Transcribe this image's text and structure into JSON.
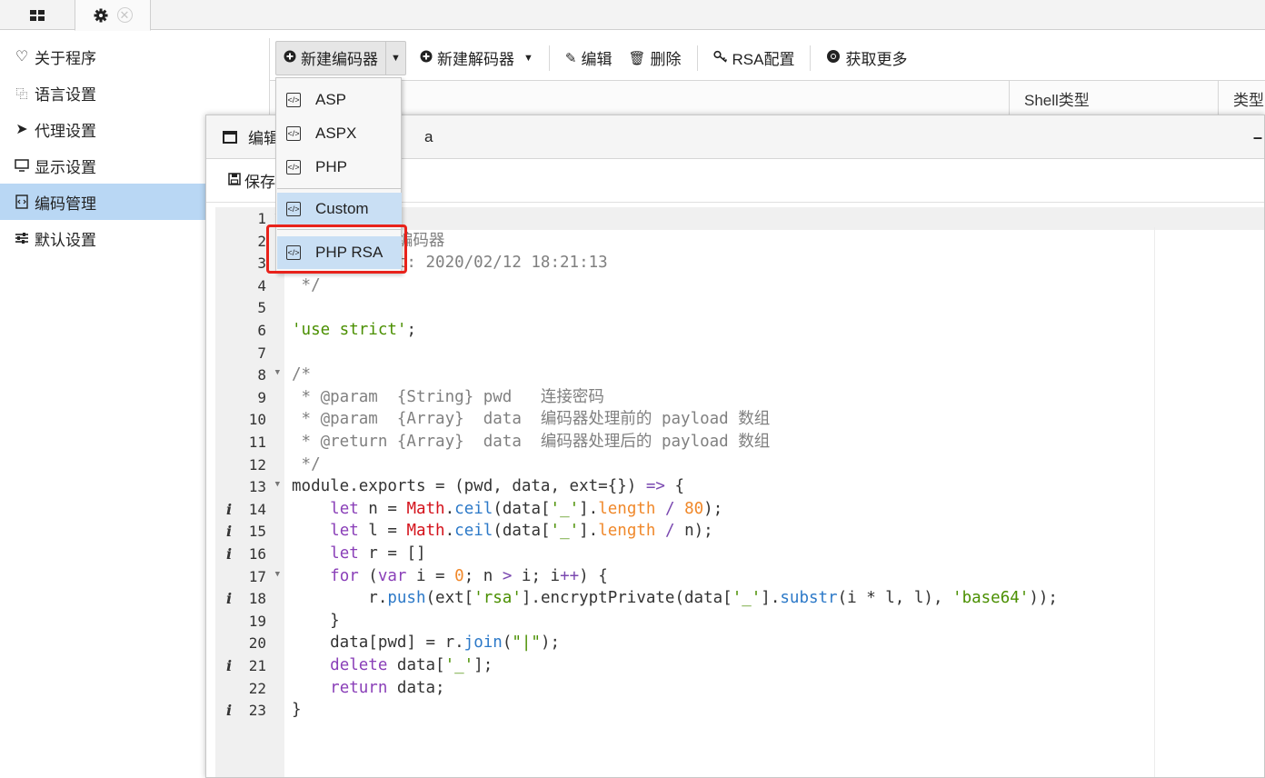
{
  "tabs": {
    "grid_icon": "grid-icon",
    "settings_icon": "gear-icon",
    "close_glyph": "✕"
  },
  "sidebar": {
    "items": [
      {
        "label": "关于程序",
        "icon": "heart-icon",
        "glyph": "♡"
      },
      {
        "label": "语言设置",
        "icon": "language-icon",
        "glyph": "🈁"
      },
      {
        "label": "代理设置",
        "icon": "paper-plane-icon",
        "glyph": "➤"
      },
      {
        "label": "显示设置",
        "icon": "monitor-icon",
        "glyph": "🖵"
      },
      {
        "label": "编码管理",
        "icon": "code-file-icon",
        "glyph": "▣"
      },
      {
        "label": "默认设置",
        "icon": "sliders-icon",
        "glyph": "☰"
      }
    ],
    "active_index": 4
  },
  "toolbar": {
    "new_encoder": "新建编码器",
    "new_decoder": "新建解码器",
    "edit": "编辑",
    "delete": "删除",
    "rsa_config": "RSA配置",
    "get_more": "获取更多"
  },
  "grid_header": {
    "shell_type": "Shell类型",
    "type": "类型"
  },
  "dropdown": {
    "items": [
      "ASP",
      "ASPX",
      "PHP",
      "Custom",
      "PHP RSA"
    ],
    "selected": "Custom"
  },
  "editor_window": {
    "title_visible": "编辑",
    "title_tail": "a",
    "save_label": "保存"
  },
  "code": {
    "lines": [
      "/**",
      " * php::RSA编码器",
      " * Create at: 2020/02/12 18:21:13",
      " */",
      "",
      "'use strict';",
      "",
      "/*",
      " * @param  {String} pwd   连接密码",
      " * @param  {Array}  data  编码器处理前的 payload 数组",
      " * @return {Array}  data  编码器处理后的 payload 数组",
      " */",
      "module.exports = (pwd, data, ext={}) => {",
      "    let n = Math.ceil(data['_'].length / 80);",
      "    let l = Math.ceil(data['_'].length / n);",
      "    let r = []",
      "    for (var i = 0; n > i; i++) {",
      "        r.push(ext['rsa'].encryptPrivate(data['_'].substr(i * l, l), 'base64'));",
      "    }",
      "    data[pwd] = r.join(\"|\");",
      "    delete data['_'];",
      "    return data;",
      "}"
    ],
    "line_numbers": [
      "1",
      "2",
      "3",
      "4",
      "5",
      "6",
      "7",
      "8",
      "9",
      "10",
      "11",
      "12",
      "13",
      "14",
      "15",
      "16",
      "17",
      "18",
      "19",
      "20",
      "21",
      "22",
      "23"
    ],
    "info_lines": [
      "14",
      "15",
      "16",
      "18",
      "21",
      "23"
    ]
  }
}
